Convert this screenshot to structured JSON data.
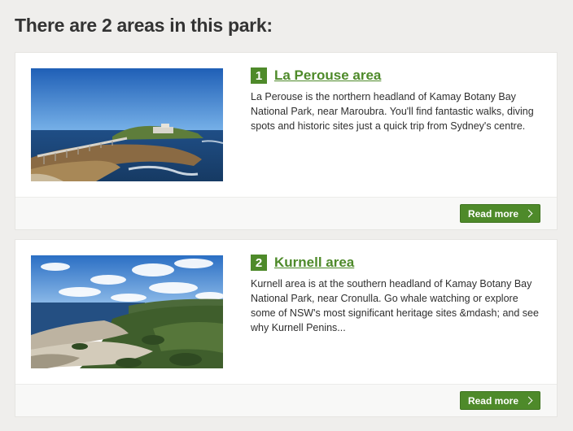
{
  "heading": "There are 2 areas in this park:",
  "colors": {
    "accent": "#4e8a2a",
    "background": "#efeeec"
  },
  "areas": [
    {
      "number": "1",
      "title": "La Perouse area",
      "description": "La Perouse is the northern headland of Kamay Botany Bay National Park, near Maroubra. You'll find fantastic walks, diving spots and historic sites just a quick trip from Sydney's centre.",
      "read_more": "Read more",
      "image": "coastal-headland-with-bridge-photo"
    },
    {
      "number": "2",
      "title": "Kurnell area",
      "description": "Kurnell area is at the southern headland of Kamay Botany Bay National Park, near Cronulla. Go whale watching or explore some of NSW's most significant heritage sites &mdash; and see why Kurnell Penins...",
      "read_more": "Read more",
      "image": "coastal-cliffs-with-bushland-photo"
    }
  ]
}
